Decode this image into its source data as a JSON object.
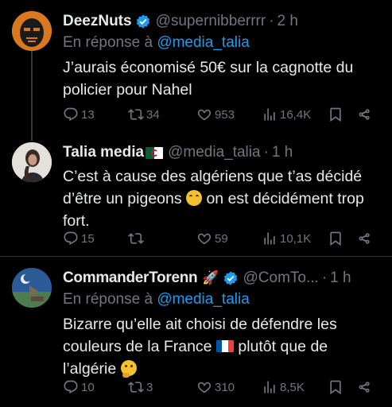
{
  "tweets": [
    {
      "name": "DeezNuts",
      "handle": "@supernibberrrr",
      "time": "2 h",
      "reply_prefix": "En réponse à",
      "reply_mention": "@media_talia",
      "text": "J’aurais économisé 50€ sur la cagnotte du policier pour Nahel",
      "replies": "13",
      "retweets": "34",
      "likes": "953",
      "views": "16,4K"
    },
    {
      "name": "Talia media",
      "handle": "@media_talia",
      "time": "1 h",
      "text_part1": "C’est à cause des algériens que t’as décidé d’être un pigeons",
      "text_part2": " on est décidément trop fort.",
      "replies": "15",
      "retweets": "",
      "likes": "59",
      "views": "10,1K"
    },
    {
      "name": "CommanderTorenn",
      "handle": "@ComTo...",
      "time": "1 h",
      "reply_prefix": "En réponse à",
      "reply_mention": "@media_talia",
      "text_part1": "Bizarre qu’elle ait choisi de défendre les couleurs de la France",
      "text_part2": " plutôt que de l’algérie",
      "replies": "10",
      "retweets": "3",
      "likes": "310",
      "views": "8,5K"
    }
  ],
  "separator": "·",
  "icons": [
    "reply-icon",
    "retweet-icon",
    "like-icon",
    "views-icon",
    "bookmark-icon",
    "share-icon",
    "verified-badge-icon"
  ],
  "colors": {
    "background": "#000000",
    "text": "#e7e9ea",
    "muted": "#71767b",
    "link": "#1d9bf0",
    "verified": "#1d9bf0"
  }
}
